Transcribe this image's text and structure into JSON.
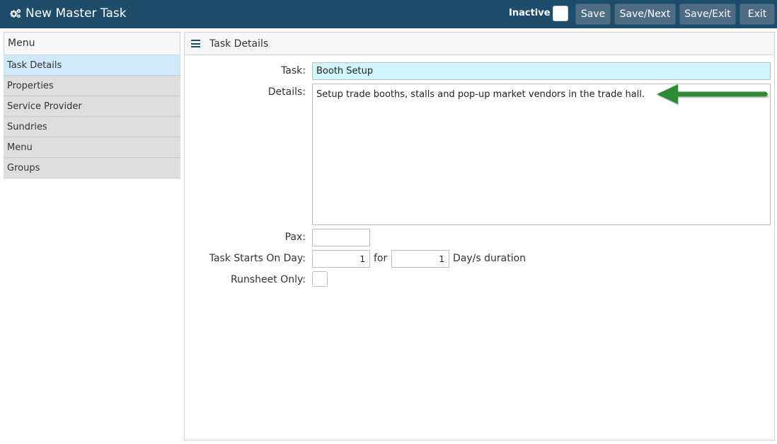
{
  "header": {
    "title": "New Master Task",
    "title_icon": "gears-icon",
    "inactive_label": "Inactive",
    "buttons": {
      "save": "Save",
      "save_next": "Save/Next",
      "save_exit": "Save/Exit",
      "exit": "Exit"
    }
  },
  "sidebar": {
    "heading": "Menu",
    "items": [
      {
        "label": "Task Details",
        "active": true
      },
      {
        "label": "Properties"
      },
      {
        "label": "Service Provider"
      },
      {
        "label": "Sundries"
      },
      {
        "label": "Menu"
      },
      {
        "label": "Groups"
      }
    ]
  },
  "panel": {
    "heading": "Task Details",
    "heading_icon": "hamburger-icon"
  },
  "form": {
    "task_label": "Task:",
    "task_value": "Booth Setup",
    "details_label": "Details:",
    "details_value": "Setup trade booths, stalls and pop-up market vendors in the trade hall.",
    "pax_label": "Pax:",
    "pax_value": "",
    "starts_label": "Task Starts On Day:",
    "starts_value": "1",
    "for_text": "for",
    "duration_value": "1",
    "duration_text": "Day/s duration",
    "runsheet_label": "Runsheet Only:"
  },
  "annotation": {
    "arrow_color": "#2e8b35",
    "arrow_icon": "left-arrow-icon"
  },
  "colors": {
    "topbar": "#1e4d6b",
    "button": "#4d6d85",
    "active_item": "#cfe9fb",
    "task_field": "#cff7fb"
  }
}
